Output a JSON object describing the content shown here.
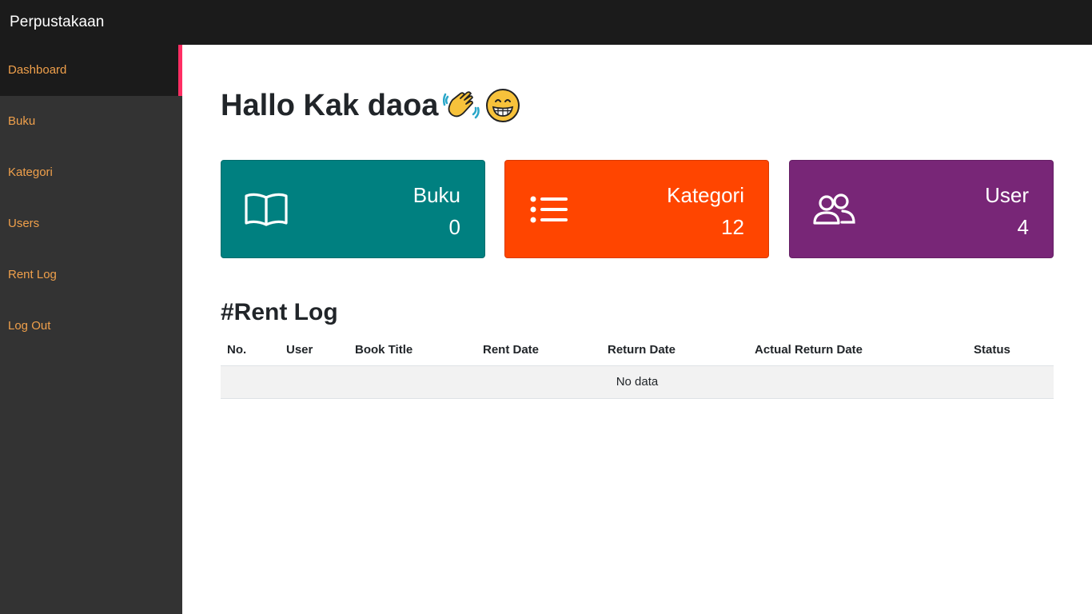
{
  "header": {
    "brand": "Perpustakaan"
  },
  "sidebar": {
    "items": [
      {
        "label": "Dashboard",
        "active": true
      },
      {
        "label": "Buku"
      },
      {
        "label": "Kategori"
      },
      {
        "label": "Users"
      },
      {
        "label": "Rent Log"
      },
      {
        "label": "Log Out"
      }
    ]
  },
  "greeting": {
    "text": "Hallo Kak daoa",
    "emojis": [
      "waving-hand-icon",
      "grinning-face-icon"
    ]
  },
  "cards": [
    {
      "label": "Buku",
      "value": "0",
      "icon": "book-icon",
      "color": "#008080"
    },
    {
      "label": "Kategori",
      "value": "12",
      "icon": "list-icon",
      "color": "#ff4500"
    },
    {
      "label": "User",
      "value": "4",
      "icon": "people-icon",
      "color": "#782677"
    }
  ],
  "rent_log": {
    "title": "#Rent Log",
    "columns": [
      "No.",
      "User",
      "Book Title",
      "Rent Date",
      "Return Date",
      "Actual Return Date",
      "Status"
    ],
    "empty_text": "No data"
  },
  "colors": {
    "topbar": "#1b1b1b",
    "sidebar": "#333333",
    "sidebar_text": "#f0a04b",
    "active_marker": "#ff2e63"
  }
}
